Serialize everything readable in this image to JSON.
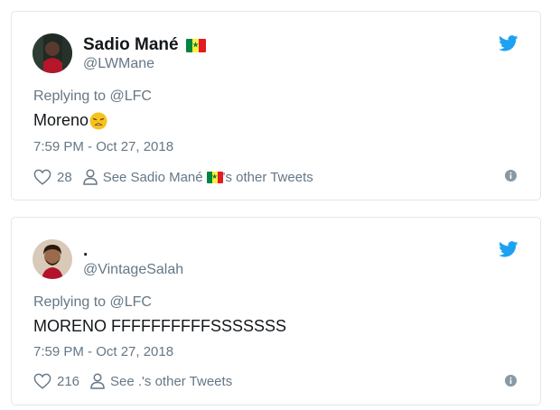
{
  "tweets": [
    {
      "display_name": "Sadio Mané",
      "handle": "@LWMane",
      "replying_to": "Replying to @LFC",
      "text": "Moreno",
      "text_emoji": "weary-face-emoji",
      "timestamp": "7:59 PM - Oct 27, 2018",
      "likes": "28",
      "see_other_prefix": "See Sadio Mané",
      "see_other_suffix": "'s other Tweets",
      "name_flag": "senegal-flag-icon"
    },
    {
      "display_name": ".",
      "handle": "@VintageSalah",
      "replying_to": "Replying to @LFC",
      "text": "MORENO FFFFFFFFFFSSSSSSS",
      "timestamp": "7:59 PM - Oct 27, 2018",
      "likes": "216",
      "see_other": "See .'s other Tweets"
    }
  ],
  "colors": {
    "twitter_blue": "#1da1f2",
    "secondary_text": "#657786",
    "border": "#e1e8ed"
  }
}
